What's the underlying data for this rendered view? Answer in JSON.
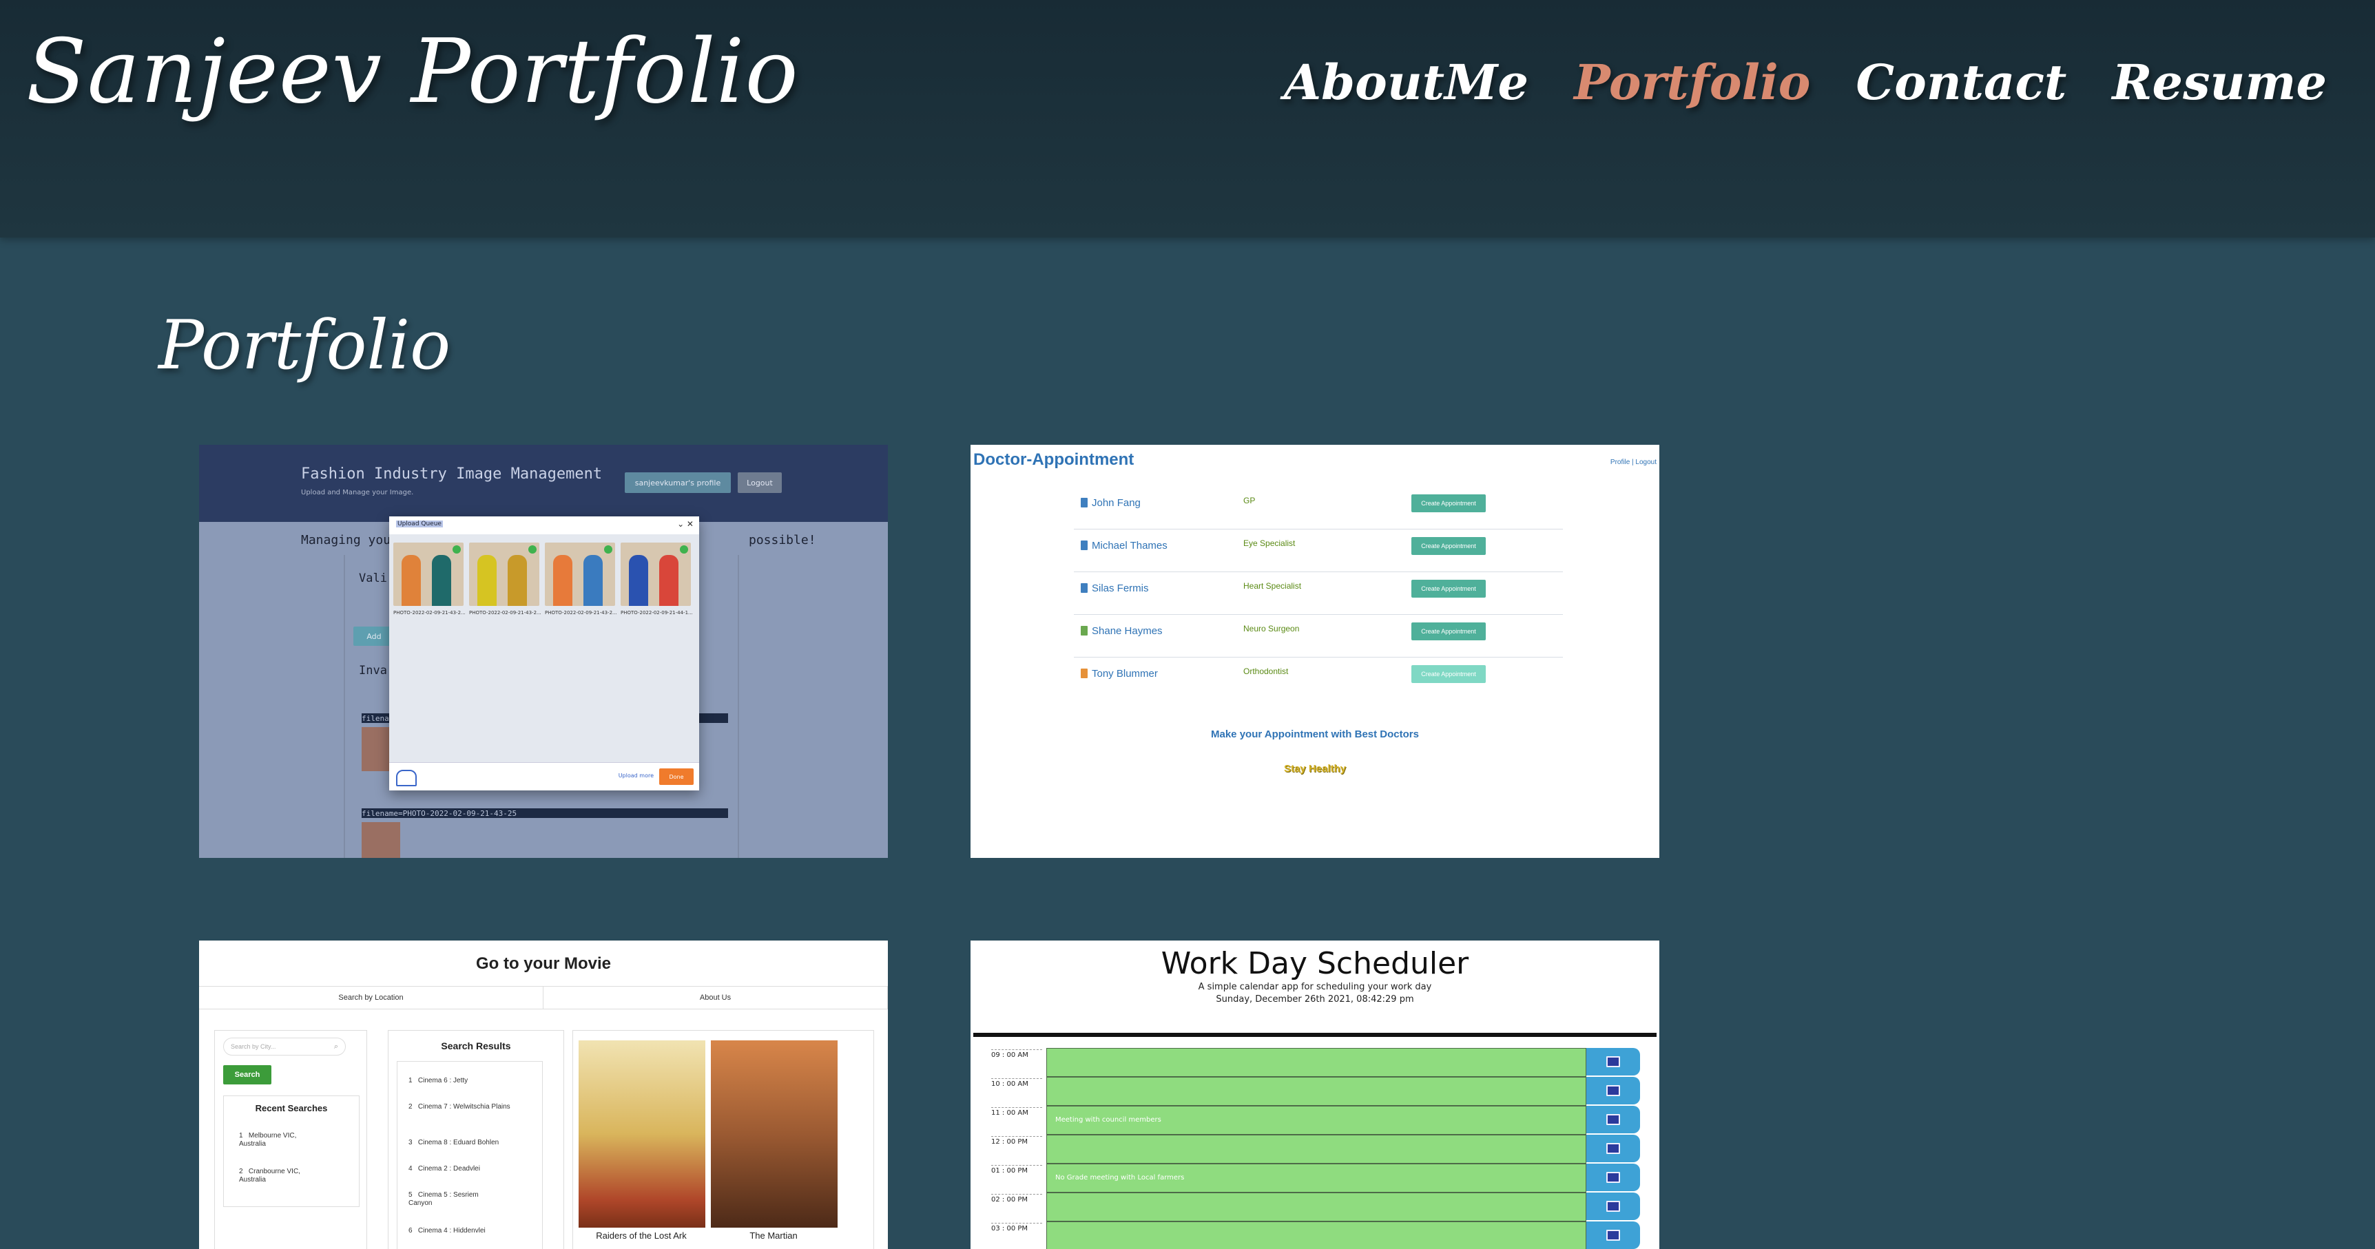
{
  "header": {
    "brand": "Sanjeev Portfolio",
    "nav": [
      "AboutMe",
      "Portfolio",
      "Contact",
      "Resume"
    ],
    "active_nav": "Portfolio",
    "active_color": "#d88a70"
  },
  "main": {
    "title": "Portfolio"
  },
  "projects": [
    {
      "id": "fashion",
      "title": "Fashion Industry Image Management",
      "subtitle": "Upload and Manage your Image.",
      "profile_button": "sanjeevkumar's profile",
      "logout_button": "Logout",
      "body_text": "Managing your",
      "body_text_end": "possible!",
      "label_valid": "Vali",
      "label_invalid": "Inva",
      "add_button": "Add",
      "file_bar_1": "filena",
      "file_bar_2": "filename=PHOTO-2022-02-09-21-43-25",
      "modal_title": "Upload Queue",
      "captions": [
        "PHOTO-2022-02-09-21-43-2...",
        "PHOTO-2022-02-09-21-43-2...",
        "PHOTO-2022-02-09-21-43-2...",
        "PHOTO-2022-02-09-21-44-1..."
      ],
      "upload_more": "Upload more",
      "done": "Done"
    },
    {
      "id": "doctor",
      "title": "Doctor-Appointment",
      "links": "Profile | Logout",
      "doctors": [
        {
          "name": "John Fang",
          "specialty": "GP",
          "book_color": "#3f7fbf"
        },
        {
          "name": "Michael Thames",
          "specialty": "Eye Specialist",
          "book_color": "#3f7fbf"
        },
        {
          "name": "Silas Fermis",
          "specialty": "Heart Specialist",
          "book_color": "#3f7fbf"
        },
        {
          "name": "Shane Haymes",
          "specialty": "Neuro Surgeon",
          "book_color": "#6aa84f"
        },
        {
          "name": "Tony Blummer",
          "specialty": "Orthodontist",
          "book_color": "#e69138"
        }
      ],
      "button_label": "Create Appointment",
      "tagline": "Make your Appointment with Best Doctors",
      "slogan": "Stay Healthy"
    },
    {
      "id": "movie",
      "title": "Go to your Movie",
      "tabs": [
        "Search by Location",
        "About Us"
      ],
      "search_placeholder": "Search by City...",
      "search_button": "Search",
      "recent_heading": "Recent Searches",
      "recent": [
        "Melbourne VIC, Australia",
        "Cranbourne VIC, Australia"
      ],
      "results_heading": "Search Results",
      "results": [
        "Cinema 6 : Jetty",
        "Cinema 7 : Welwitschia Plains",
        "Cinema 8 : Eduard Bohlen",
        "Cinema 2 : Deadvlei",
        "Cinema 5 : Sesriem Canyon",
        "Cinema 4 : Hiddenvlei"
      ],
      "movies": [
        "Raiders of the Lost Ark",
        "The Martian"
      ]
    },
    {
      "id": "scheduler",
      "title": "Work Day Scheduler",
      "subtitle": "A simple calendar app for scheduling your work day",
      "date": "Sunday, December 26th 2021, 08:42:29 pm",
      "hours": [
        {
          "hour": "09 : 00 AM",
          "note": ""
        },
        {
          "hour": "10 : 00 AM",
          "note": ""
        },
        {
          "hour": "11 : 00 AM",
          "note": "Meeting with council members"
        },
        {
          "hour": "12 : 00 PM",
          "note": ""
        },
        {
          "hour": "01 : 00 PM",
          "note": "No Grade meeting with Local farmers"
        },
        {
          "hour": "02 : 00 PM",
          "note": ""
        },
        {
          "hour": "03 : 00 PM",
          "note": ""
        }
      ]
    }
  ]
}
